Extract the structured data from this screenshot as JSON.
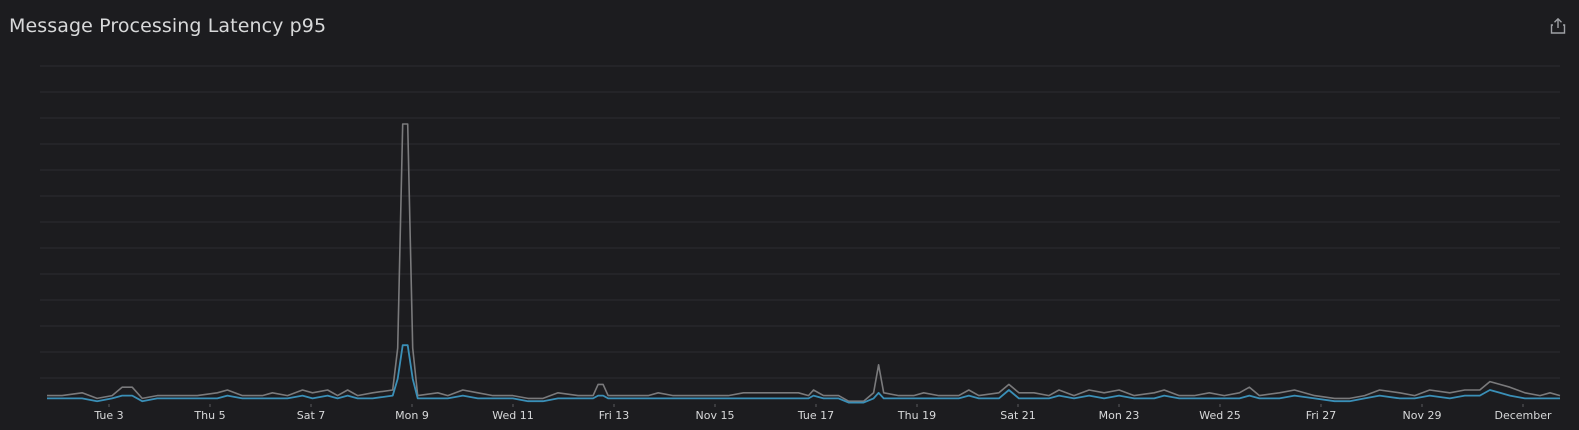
{
  "panel": {
    "title": "Message Processing Latency p95"
  },
  "icons": {
    "share": "share-icon"
  },
  "colors": {
    "background": "#1c1c1f",
    "grid": "#2c2c30",
    "series_primary": "#3a8fb7",
    "series_secondary": "#7a7a7c",
    "text": "#d8d9da"
  },
  "chart_data": {
    "type": "line",
    "title": "Message Processing Latency p95",
    "xlabel": "",
    "ylabel": "",
    "x_ticks": [
      "Tue 3",
      "Thu 5",
      "Sat 7",
      "Mon 9",
      "Wed 11",
      "Fri 13",
      "Nov 15",
      "Tue 17",
      "Thu 19",
      "Sat 21",
      "Mon 23",
      "Wed 25",
      "Fri 27",
      "Nov 29",
      "December"
    ],
    "x_range_days": [
      0,
      30.2
    ],
    "ylim": [
      0,
      13
    ],
    "grid": true,
    "legend": "none",
    "series": [
      {
        "color": "#7a7a7c",
        "values": [
          [
            0,
            0.3
          ],
          [
            0.3,
            0.3
          ],
          [
            0.7,
            0.4
          ],
          [
            1.0,
            0.2
          ],
          [
            1.3,
            0.3
          ],
          [
            1.5,
            0.6
          ],
          [
            1.7,
            0.6
          ],
          [
            1.9,
            0.2
          ],
          [
            2.2,
            0.3
          ],
          [
            2.6,
            0.3
          ],
          [
            3.0,
            0.3
          ],
          [
            3.4,
            0.4
          ],
          [
            3.6,
            0.5
          ],
          [
            3.9,
            0.3
          ],
          [
            4.3,
            0.3
          ],
          [
            4.5,
            0.4
          ],
          [
            4.8,
            0.3
          ],
          [
            5.1,
            0.5
          ],
          [
            5.3,
            0.4
          ],
          [
            5.6,
            0.5
          ],
          [
            5.8,
            0.3
          ],
          [
            6.0,
            0.5
          ],
          [
            6.2,
            0.3
          ],
          [
            6.5,
            0.4
          ],
          [
            6.9,
            0.5
          ],
          [
            7.0,
            2.0
          ],
          [
            7.1,
            10.0
          ],
          [
            7.2,
            10.0
          ],
          [
            7.3,
            2.0
          ],
          [
            7.4,
            0.3
          ],
          [
            7.8,
            0.4
          ],
          [
            8.0,
            0.3
          ],
          [
            8.3,
            0.5
          ],
          [
            8.6,
            0.4
          ],
          [
            8.9,
            0.3
          ],
          [
            9.3,
            0.3
          ],
          [
            9.6,
            0.2
          ],
          [
            9.9,
            0.2
          ],
          [
            10.2,
            0.4
          ],
          [
            10.6,
            0.3
          ],
          [
            10.9,
            0.3
          ],
          [
            11.0,
            0.7
          ],
          [
            11.1,
            0.7
          ],
          [
            11.2,
            0.3
          ],
          [
            11.6,
            0.3
          ],
          [
            12.0,
            0.3
          ],
          [
            12.2,
            0.4
          ],
          [
            12.5,
            0.3
          ],
          [
            12.9,
            0.3
          ],
          [
            13.3,
            0.3
          ],
          [
            13.6,
            0.3
          ],
          [
            13.9,
            0.4
          ],
          [
            14.2,
            0.4
          ],
          [
            14.6,
            0.4
          ],
          [
            15.0,
            0.4
          ],
          [
            15.2,
            0.3
          ],
          [
            15.3,
            0.5
          ],
          [
            15.5,
            0.3
          ],
          [
            15.8,
            0.3
          ],
          [
            16.0,
            0.1
          ],
          [
            16.3,
            0.1
          ],
          [
            16.5,
            0.4
          ],
          [
            16.6,
            1.4
          ],
          [
            16.7,
            0.4
          ],
          [
            17.0,
            0.3
          ],
          [
            17.3,
            0.3
          ],
          [
            17.5,
            0.4
          ],
          [
            17.8,
            0.3
          ],
          [
            18.2,
            0.3
          ],
          [
            18.4,
            0.5
          ],
          [
            18.6,
            0.3
          ],
          [
            19.0,
            0.4
          ],
          [
            19.2,
            0.7
          ],
          [
            19.4,
            0.4
          ],
          [
            19.7,
            0.4
          ],
          [
            20.0,
            0.3
          ],
          [
            20.2,
            0.5
          ],
          [
            20.5,
            0.3
          ],
          [
            20.8,
            0.5
          ],
          [
            21.1,
            0.4
          ],
          [
            21.4,
            0.5
          ],
          [
            21.7,
            0.3
          ],
          [
            22.1,
            0.4
          ],
          [
            22.3,
            0.5
          ],
          [
            22.6,
            0.3
          ],
          [
            22.9,
            0.3
          ],
          [
            23.2,
            0.4
          ],
          [
            23.5,
            0.3
          ],
          [
            23.8,
            0.4
          ],
          [
            24.0,
            0.6
          ],
          [
            24.2,
            0.3
          ],
          [
            24.6,
            0.4
          ],
          [
            24.9,
            0.5
          ],
          [
            25.3,
            0.3
          ],
          [
            25.7,
            0.2
          ],
          [
            26.0,
            0.2
          ],
          [
            26.3,
            0.3
          ],
          [
            26.6,
            0.5
          ],
          [
            27.0,
            0.4
          ],
          [
            27.3,
            0.3
          ],
          [
            27.6,
            0.5
          ],
          [
            28.0,
            0.4
          ],
          [
            28.3,
            0.5
          ],
          [
            28.6,
            0.5
          ],
          [
            28.8,
            0.8
          ],
          [
            29.0,
            0.7
          ],
          [
            29.2,
            0.6
          ],
          [
            29.5,
            0.4
          ],
          [
            29.8,
            0.3
          ],
          [
            30.0,
            0.4
          ],
          [
            30.2,
            0.3
          ]
        ]
      },
      {
        "color": "#3a8fb7",
        "values": [
          [
            0,
            0.2
          ],
          [
            0.3,
            0.2
          ],
          [
            0.7,
            0.2
          ],
          [
            1.0,
            0.1
          ],
          [
            1.3,
            0.2
          ],
          [
            1.5,
            0.3
          ],
          [
            1.7,
            0.3
          ],
          [
            1.9,
            0.1
          ],
          [
            2.2,
            0.2
          ],
          [
            2.6,
            0.2
          ],
          [
            3.0,
            0.2
          ],
          [
            3.4,
            0.2
          ],
          [
            3.6,
            0.3
          ],
          [
            3.9,
            0.2
          ],
          [
            4.3,
            0.2
          ],
          [
            4.5,
            0.2
          ],
          [
            4.8,
            0.2
          ],
          [
            5.1,
            0.3
          ],
          [
            5.3,
            0.2
          ],
          [
            5.6,
            0.3
          ],
          [
            5.8,
            0.2
          ],
          [
            6.0,
            0.3
          ],
          [
            6.2,
            0.2
          ],
          [
            6.5,
            0.2
          ],
          [
            6.9,
            0.3
          ],
          [
            7.0,
            0.9
          ],
          [
            7.1,
            2.1
          ],
          [
            7.2,
            2.1
          ],
          [
            7.3,
            0.9
          ],
          [
            7.4,
            0.2
          ],
          [
            7.8,
            0.2
          ],
          [
            8.0,
            0.2
          ],
          [
            8.3,
            0.3
          ],
          [
            8.6,
            0.2
          ],
          [
            8.9,
            0.2
          ],
          [
            9.3,
            0.2
          ],
          [
            9.6,
            0.1
          ],
          [
            9.9,
            0.1
          ],
          [
            10.2,
            0.2
          ],
          [
            10.6,
            0.2
          ],
          [
            10.9,
            0.2
          ],
          [
            11.0,
            0.3
          ],
          [
            11.1,
            0.3
          ],
          [
            11.2,
            0.2
          ],
          [
            11.6,
            0.2
          ],
          [
            12.0,
            0.2
          ],
          [
            12.2,
            0.2
          ],
          [
            12.5,
            0.2
          ],
          [
            12.9,
            0.2
          ],
          [
            13.3,
            0.2
          ],
          [
            13.6,
            0.2
          ],
          [
            13.9,
            0.2
          ],
          [
            14.2,
            0.2
          ],
          [
            14.6,
            0.2
          ],
          [
            15.0,
            0.2
          ],
          [
            15.2,
            0.2
          ],
          [
            15.3,
            0.3
          ],
          [
            15.5,
            0.2
          ],
          [
            15.8,
            0.2
          ],
          [
            16.0,
            0.05
          ],
          [
            16.3,
            0.05
          ],
          [
            16.5,
            0.2
          ],
          [
            16.6,
            0.4
          ],
          [
            16.7,
            0.2
          ],
          [
            17.0,
            0.2
          ],
          [
            17.3,
            0.2
          ],
          [
            17.5,
            0.2
          ],
          [
            17.8,
            0.2
          ],
          [
            18.2,
            0.2
          ],
          [
            18.4,
            0.3
          ],
          [
            18.6,
            0.2
          ],
          [
            19.0,
            0.2
          ],
          [
            19.2,
            0.5
          ],
          [
            19.4,
            0.2
          ],
          [
            19.7,
            0.2
          ],
          [
            20.0,
            0.2
          ],
          [
            20.2,
            0.3
          ],
          [
            20.5,
            0.2
          ],
          [
            20.8,
            0.3
          ],
          [
            21.1,
            0.2
          ],
          [
            21.4,
            0.3
          ],
          [
            21.7,
            0.2
          ],
          [
            22.1,
            0.2
          ],
          [
            22.3,
            0.3
          ],
          [
            22.6,
            0.2
          ],
          [
            22.9,
            0.2
          ],
          [
            23.2,
            0.2
          ],
          [
            23.5,
            0.2
          ],
          [
            23.8,
            0.2
          ],
          [
            24.0,
            0.3
          ],
          [
            24.2,
            0.2
          ],
          [
            24.6,
            0.2
          ],
          [
            24.9,
            0.3
          ],
          [
            25.3,
            0.2
          ],
          [
            25.7,
            0.1
          ],
          [
            26.0,
            0.1
          ],
          [
            26.3,
            0.2
          ],
          [
            26.6,
            0.3
          ],
          [
            27.0,
            0.2
          ],
          [
            27.3,
            0.2
          ],
          [
            27.6,
            0.3
          ],
          [
            28.0,
            0.2
          ],
          [
            28.3,
            0.3
          ],
          [
            28.6,
            0.3
          ],
          [
            28.8,
            0.5
          ],
          [
            29.0,
            0.4
          ],
          [
            29.2,
            0.3
          ],
          [
            29.5,
            0.2
          ],
          [
            29.8,
            0.2
          ],
          [
            30.0,
            0.2
          ],
          [
            30.2,
            0.2
          ]
        ]
      }
    ]
  }
}
